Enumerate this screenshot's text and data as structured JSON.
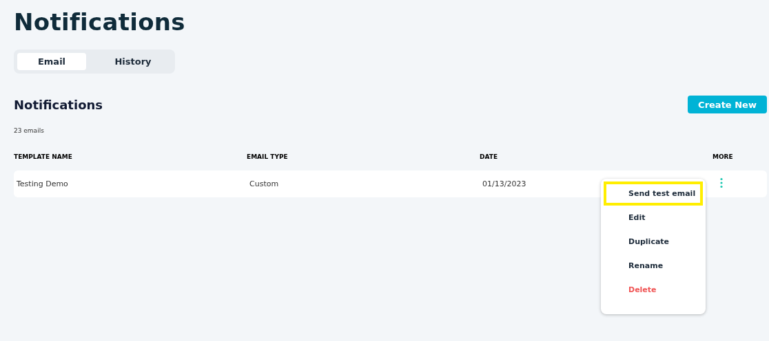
{
  "page_title": "Notifications",
  "tabs": [
    {
      "label": "Email",
      "selected": true
    },
    {
      "label": "History",
      "selected": false
    }
  ],
  "section": {
    "title": "Notifications",
    "count": "23 emails",
    "create_button": "Create New"
  },
  "table": {
    "columns": [
      "TEMPLATE NAME",
      "EMAIL TYPE",
      "DATE",
      "MORE"
    ],
    "rows": [
      {
        "cells": [
          "Testing Demo",
          "Custom",
          "01/13/2023"
        ]
      }
    ]
  },
  "context_menu": {
    "items": [
      {
        "label": "Send test email",
        "kind": "normal",
        "highlighted": true
      },
      {
        "label": "Edit",
        "kind": "normal",
        "highlighted": false
      },
      {
        "label": "Duplicate",
        "kind": "normal",
        "highlighted": false
      },
      {
        "label": "Rename",
        "kind": "normal",
        "highlighted": false
      },
      {
        "label": "Delete",
        "kind": "danger",
        "highlighted": false
      }
    ]
  }
}
